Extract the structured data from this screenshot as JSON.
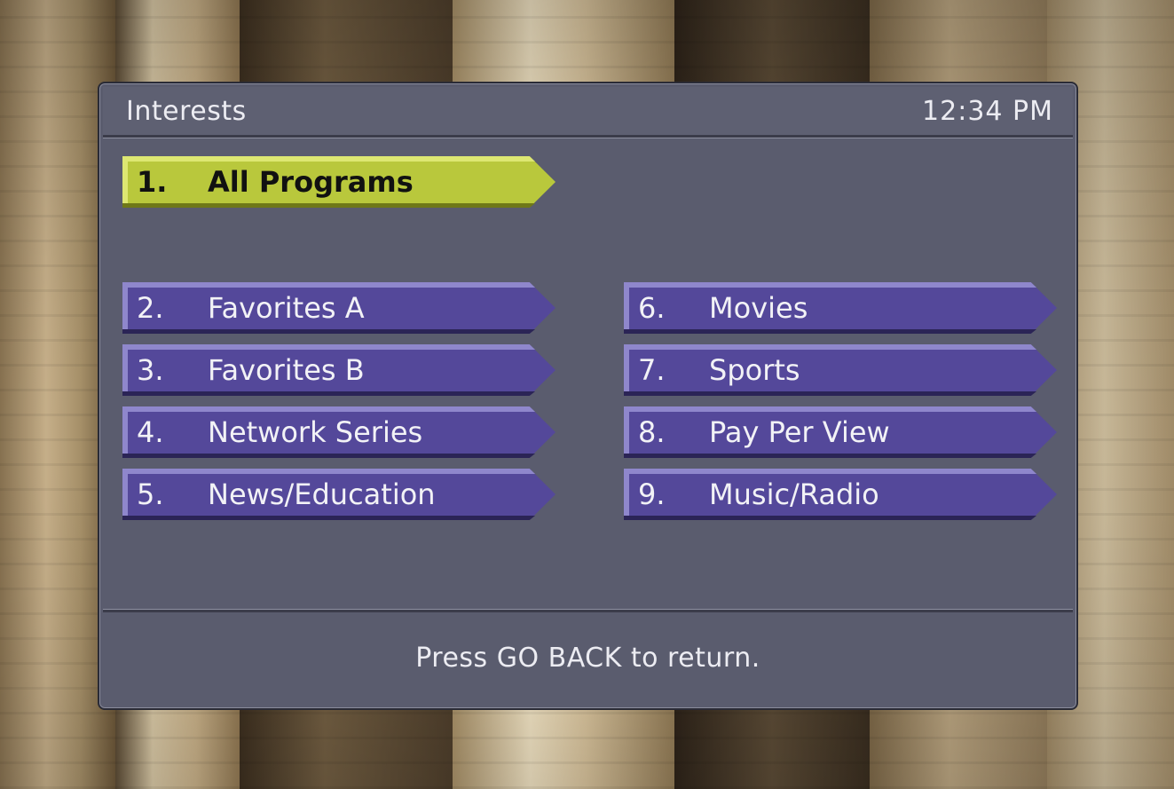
{
  "screen": {
    "title": "Interests",
    "clock": "12:34 PM"
  },
  "menu": {
    "selected_index": 0,
    "items": [
      {
        "number": "1.",
        "label": "All Programs"
      },
      {
        "number": "2.",
        "label": "Favorites A"
      },
      {
        "number": "3.",
        "label": "Favorites B"
      },
      {
        "number": "4.",
        "label": "Network Series"
      },
      {
        "number": "5.",
        "label": "News/Education"
      },
      {
        "number": "6.",
        "label": "Movies"
      },
      {
        "number": "7.",
        "label": "Sports"
      },
      {
        "number": "8.",
        "label": "Pay Per View"
      },
      {
        "number": "9.",
        "label": "Music/Radio"
      }
    ]
  },
  "footer": {
    "message": "Press GO BACK to return."
  },
  "colors": {
    "panel": "#5a5c6e",
    "button": "#54489a",
    "button_selected": "#b9c83c",
    "text": "#ececf2"
  }
}
